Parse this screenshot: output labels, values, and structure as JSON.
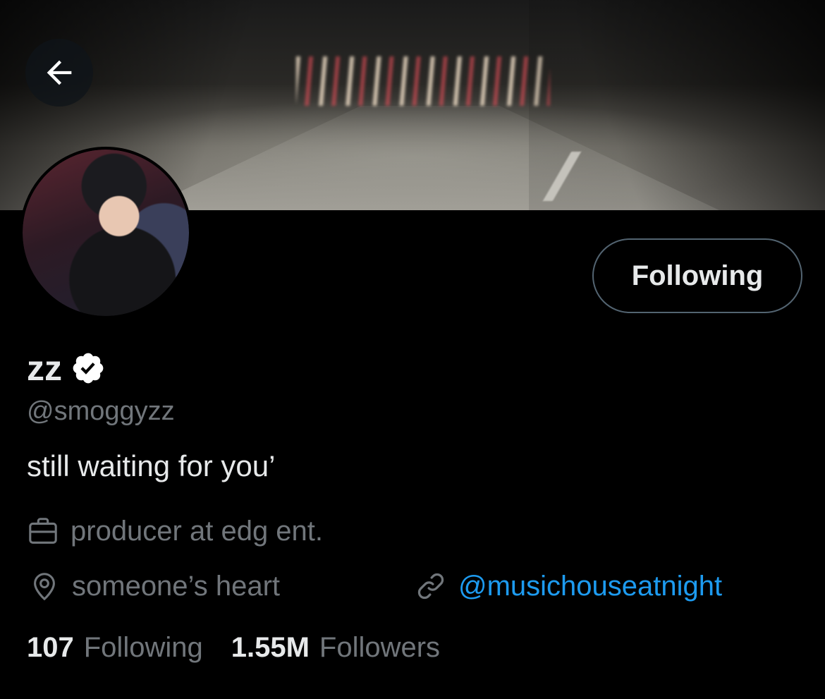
{
  "header": {
    "banner_icon": "night-road-photo",
    "back_icon": "arrow-left-icon"
  },
  "profile": {
    "avatar_icon": "profile-photo",
    "follow_button_label": "Following",
    "display_name": "zz",
    "verified_icon": "verified-badge-icon",
    "handle": "@smoggyzz",
    "bio": "still waiting for you’"
  },
  "meta": {
    "work": {
      "icon": "briefcase-icon",
      "text": "producer at edg ent."
    },
    "location": {
      "icon": "location-pin-icon",
      "text": "someone’s heart"
    },
    "link": {
      "icon": "link-icon",
      "text": "@musichouseatnight"
    }
  },
  "stats": {
    "following_count": "107",
    "following_label": "Following",
    "followers_count": "1.55M",
    "followers_label": "Followers"
  },
  "colors": {
    "background": "#000000",
    "text_primary": "#e7e9ea",
    "text_secondary": "#71767b",
    "link": "#1d9bf0",
    "button_border": "#536471"
  }
}
